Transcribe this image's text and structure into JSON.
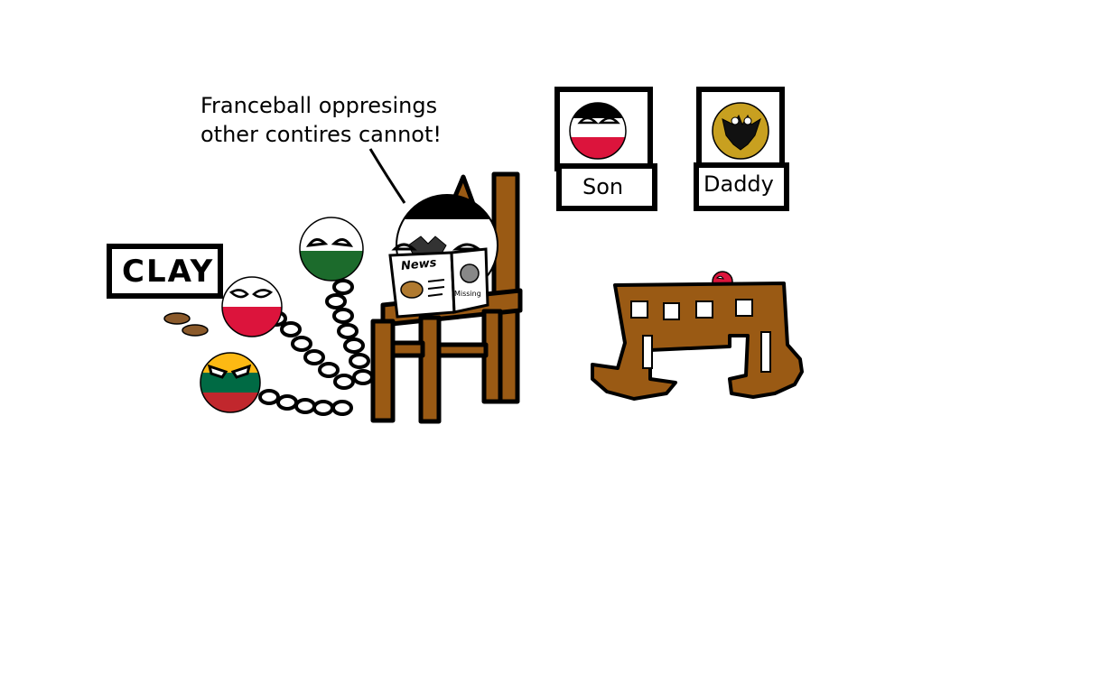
{
  "speech": {
    "line1": "Franceball oppresings",
    "line2": "other contires cannot!"
  },
  "sign": {
    "text": "CLAY"
  },
  "portraits": {
    "son_label": "Son",
    "daddy_label": "Daddy"
  },
  "newspaper": {
    "title": "News",
    "missing_label": "Missing"
  },
  "colors": {
    "wood": "#9a5a14",
    "prussia_black": "#000000",
    "poland_red": "#dc143c",
    "lithuania_yellow": "#fdb913",
    "lithuania_green": "#006a44",
    "lithuania_red": "#c1272d",
    "saxony_green": "#1c6b2c",
    "daddy_gold": "#c8a020",
    "clay_brown": "#8b5a2b"
  }
}
